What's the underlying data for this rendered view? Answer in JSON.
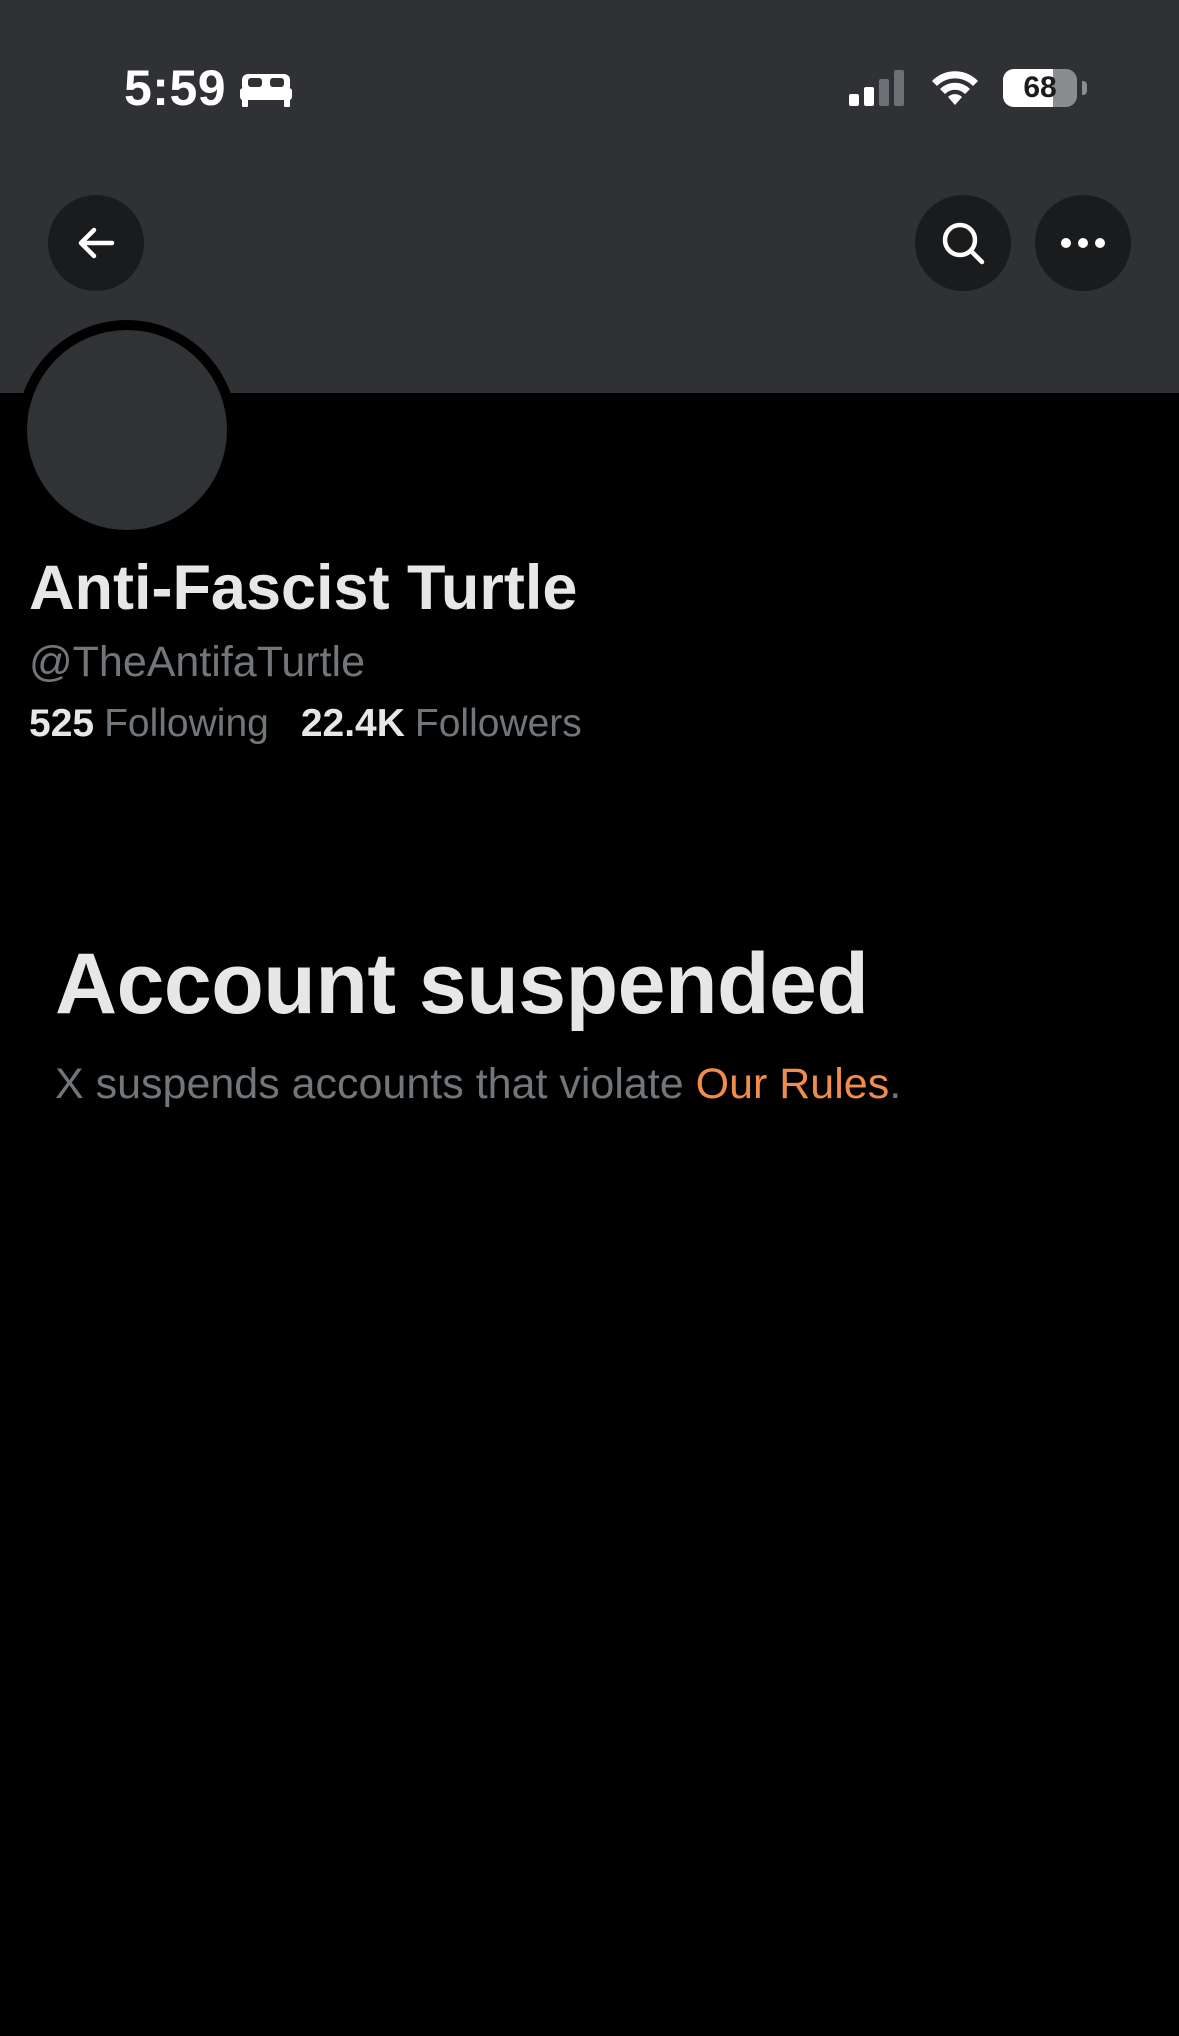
{
  "status_bar": {
    "time": "5:59",
    "battery_level": "68",
    "battery_fraction": 0.68,
    "icons": [
      "bed-icon",
      "signal-icon",
      "wifi-icon",
      "battery-icon"
    ]
  },
  "header": {
    "icons": [
      "back-arrow-icon",
      "search-icon",
      "more-icon"
    ]
  },
  "profile": {
    "display_name": "Anti-Fascist Turtle",
    "handle": "@TheAntifaTurtle",
    "following_count": "525",
    "following_label": "Following",
    "followers_count": "22.4K",
    "followers_label": "Followers"
  },
  "suspension": {
    "title": "Account suspended",
    "message_prefix": "X suspends accounts that violate ",
    "link_text": "Our Rules",
    "message_suffix": "."
  },
  "colors": {
    "background": "#000000",
    "banner": "#2f3135",
    "primary_text": "#e7e7e7",
    "secondary_text": "#71767b",
    "link": "#f18d4c"
  }
}
